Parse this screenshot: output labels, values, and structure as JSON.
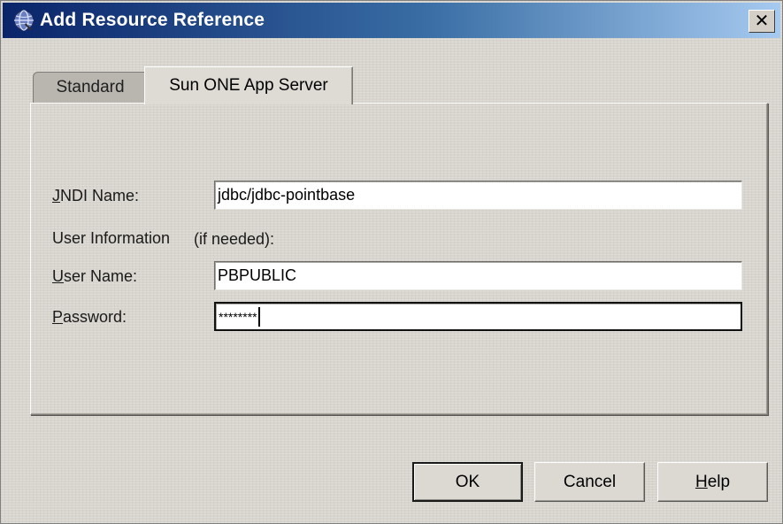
{
  "window": {
    "title": "Add Resource Reference",
    "close_label": "✕",
    "icon": "globe-app-icon"
  },
  "tabs": [
    {
      "label": "Standard",
      "selected": false
    },
    {
      "label": "Sun ONE App Server",
      "selected": true
    }
  ],
  "form": {
    "jndi_label_mnemonic": "J",
    "jndi_label_rest": "NDI Name:",
    "jndi_value": "jdbc/jdbc-pointbase",
    "user_info_label": "User Information",
    "user_info_hint": "(if needed):",
    "username_label_mnemonic": "U",
    "username_label_rest": "ser Name:",
    "username_value": "PBPUBLIC",
    "password_label_mnemonic": "P",
    "password_label_rest": "assword:",
    "password_value": "********"
  },
  "buttons": {
    "ok": "OK",
    "cancel": "Cancel",
    "help_mnemonic": "H",
    "help_rest": "elp"
  },
  "colors": {
    "title_gradient_start": "#0a246a",
    "title_gradient_end": "#a6caf0",
    "window_bg": "#d8d5ce"
  }
}
